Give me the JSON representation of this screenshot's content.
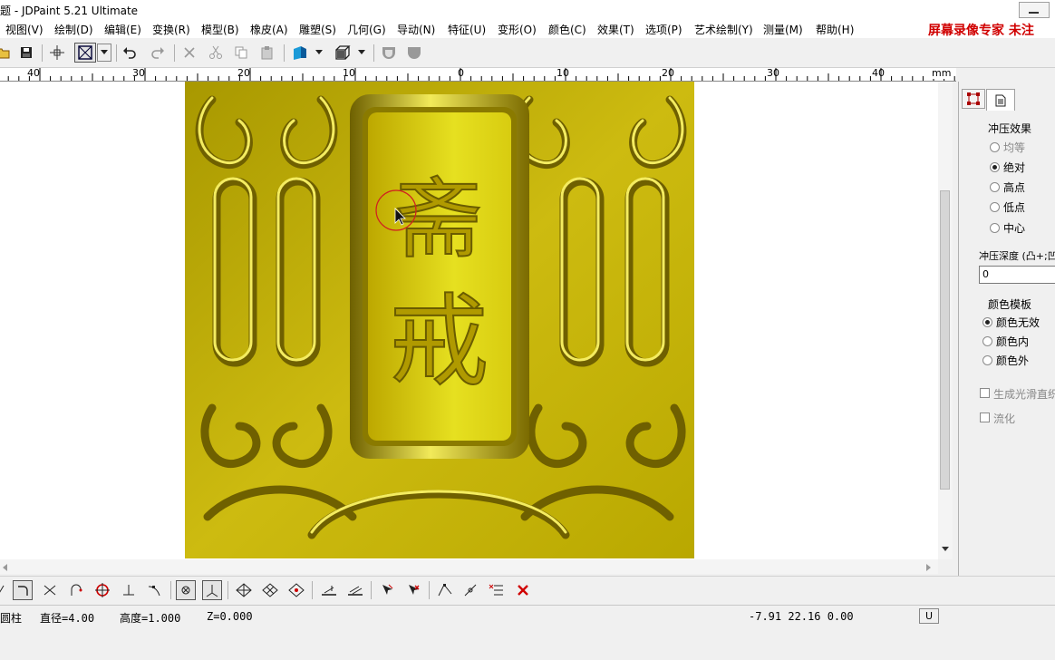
{
  "window": {
    "title": "题 - JDPaint 5.21 Ultimate"
  },
  "menu": {
    "items": [
      "视图(V)",
      "绘制(D)",
      "编辑(E)",
      "变换(R)",
      "模型(B)",
      "橡皮(A)",
      "雕塑(S)",
      "几何(G)",
      "导动(N)",
      "特征(U)",
      "变形(O)",
      "颜色(C)",
      "效果(T)",
      "选项(P)",
      "艺术绘制(Y)",
      "测量(M)",
      "帮助(H)"
    ],
    "watermark": "屏幕录像专家  未注"
  },
  "ruler": {
    "unit": "mm",
    "labels": [
      "40",
      "30",
      "20",
      "10",
      "0",
      "10",
      "20",
      "30",
      "40"
    ]
  },
  "canvas": {
    "characters": [
      "斋",
      "戒"
    ],
    "relief_color": "#c8b400"
  },
  "panel": {
    "press_effect_title": "冲压效果",
    "press_options": [
      "均等",
      "绝对",
      "高点",
      "低点",
      "中心"
    ],
    "press_selected": "绝对",
    "depth_label": "冲压深度 (凸+;凹",
    "depth_value": "0",
    "color_template_title": "颜色模板",
    "color_options": [
      "颜色无效",
      "颜色内",
      "颜色外"
    ],
    "color_selected": "颜色无效",
    "smooth_label": "生成光滑直织",
    "flow_label": "流化"
  },
  "status": {
    "tool": "圆柱",
    "diameter": "直径=4.00",
    "height": "高度=1.000",
    "z": "Z=0.000",
    "coords": "-7.91  22.16  0.00",
    "unit_button": "U"
  },
  "colors": {
    "accent_red": "#d00000",
    "relief_gold": "#c8b400"
  }
}
